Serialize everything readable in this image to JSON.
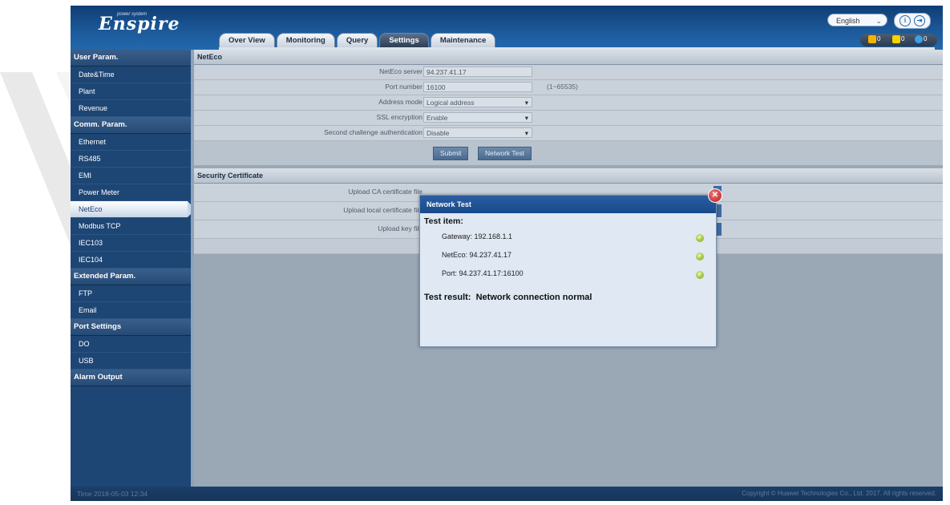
{
  "app": {
    "logo": "Enspire",
    "logo_tagline": "power system",
    "language": "English"
  },
  "tabs": [
    "Over View",
    "Monitoring",
    "Query",
    "Settings",
    "Maintenance"
  ],
  "active_tab": "Settings",
  "alarms": {
    "major": "0",
    "minor": "0",
    "warning": "0"
  },
  "sidebar": {
    "sections": [
      {
        "title": "User Param.",
        "items": [
          "Date&Time",
          "Plant",
          "Revenue"
        ]
      },
      {
        "title": "Comm. Param.",
        "items": [
          "Ethernet",
          "RS485",
          "EMI",
          "Power Meter",
          "NetEco",
          "Modbus TCP",
          "IEC103",
          "IEC104"
        ]
      },
      {
        "title": "Extended Param.",
        "items": [
          "FTP",
          "Email"
        ]
      },
      {
        "title": "Port Settings",
        "items": [
          "DO",
          "USB"
        ]
      },
      {
        "title": "Alarm Output",
        "items": []
      }
    ],
    "active_item": "NetEco"
  },
  "neteco": {
    "header": "NetEco",
    "rows": [
      {
        "label": "NetEco server",
        "value": "94.237.41.17",
        "type": "text"
      },
      {
        "label": "Port number",
        "value": "16100",
        "type": "text",
        "range": "(1~65535)"
      },
      {
        "label": "Address mode",
        "value": "Logical address",
        "type": "select"
      },
      {
        "label": "SSL encryption",
        "value": "Enable",
        "type": "select"
      },
      {
        "label": "Second challenge authentication",
        "value": "Disable",
        "type": "select"
      }
    ],
    "submit": "Submit",
    "network_test": "Network Test"
  },
  "certificate": {
    "header": "Security Certificate",
    "rows": [
      "Upload CA certificate file",
      "Upload local certificate file",
      "Upload key file"
    ]
  },
  "dialog": {
    "title": "Network Test",
    "heading": "Test item:",
    "items": [
      "Gateway: 192.168.1.1",
      "NetEco: 94.237.41.17",
      "Port: 94.237.41.17:16100"
    ],
    "result_label": "Test result:",
    "result_value": "Network connection normal"
  },
  "footer": {
    "time": "Time  2018-05-03 12:34",
    "copyright": "Copyright © Huawei Technologies Co., Ltd. 2017. All rights reserved."
  }
}
